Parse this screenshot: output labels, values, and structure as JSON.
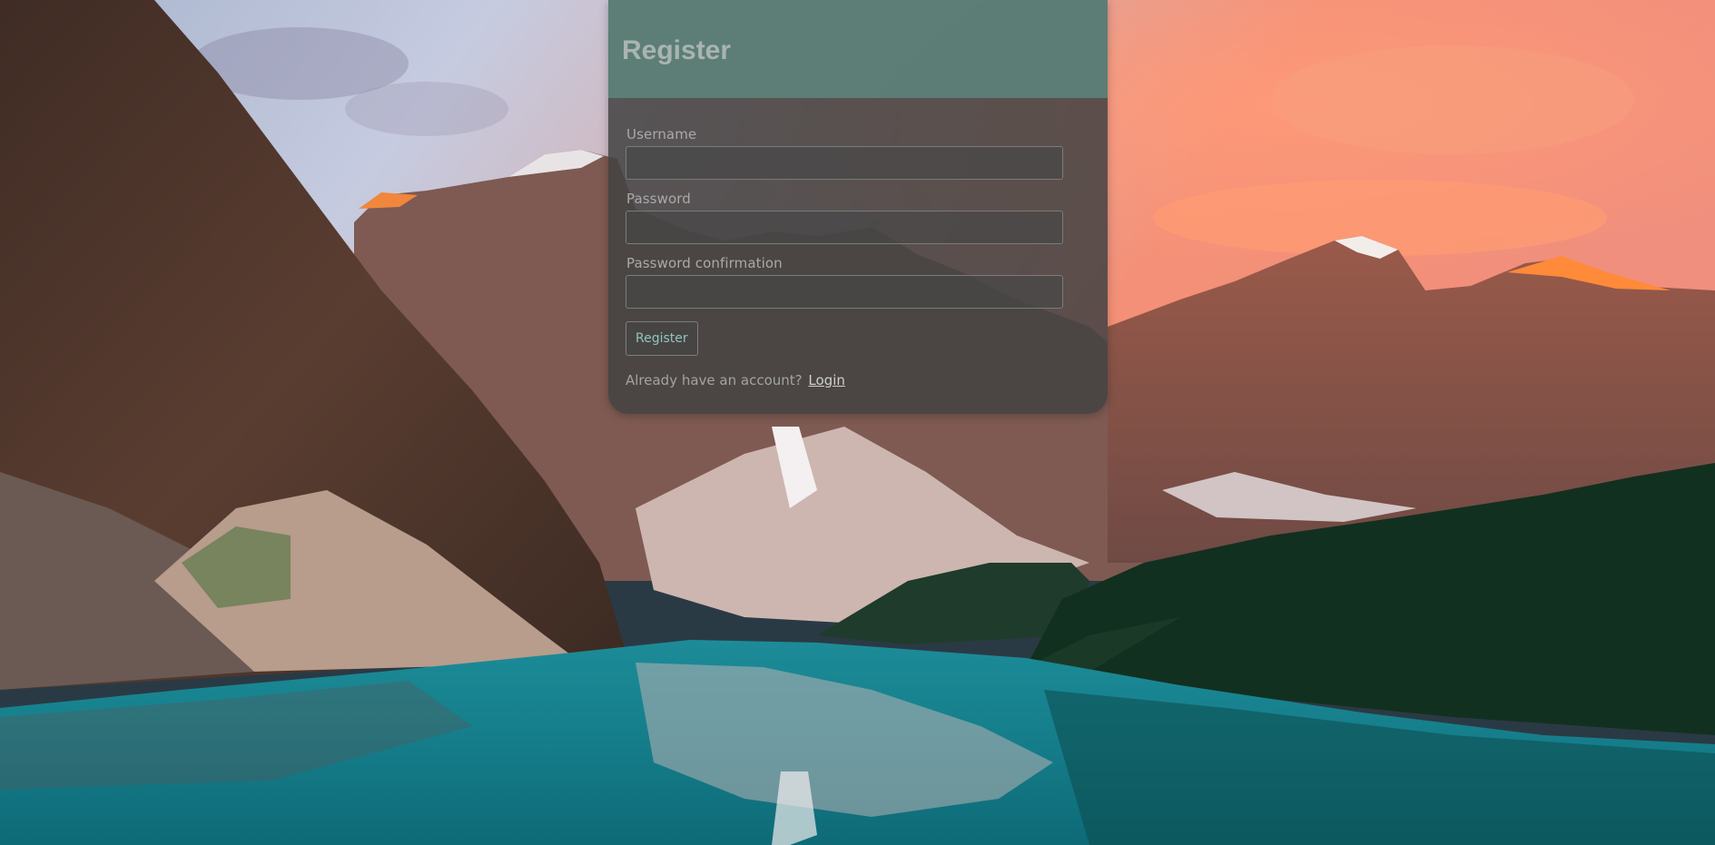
{
  "form": {
    "title": "Register",
    "fields": [
      {
        "label": "Username",
        "value": "",
        "placeholder": ""
      },
      {
        "label": "Password",
        "value": "",
        "placeholder": ""
      },
      {
        "label": "Password confirmation",
        "value": "",
        "placeholder": ""
      }
    ],
    "submit_label": "Register",
    "account_prompt": "Already have an account?",
    "login_link": "Login"
  },
  "background": {
    "description": "mountain lake landscape at sunset"
  },
  "colors": {
    "header": "#5c817a",
    "card": "#424242",
    "button_text": "#8fc5bd",
    "lake": "#1b8a96",
    "sky_left": "#b8c2d8",
    "sky_right": "#f28a74"
  }
}
